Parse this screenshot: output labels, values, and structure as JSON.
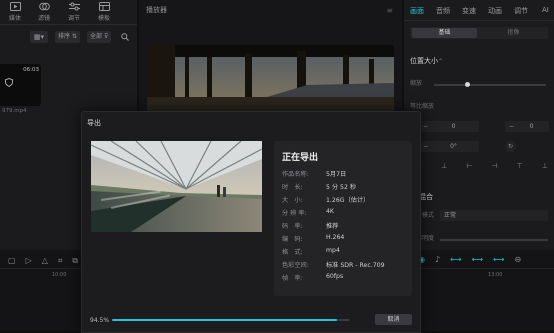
{
  "left_panel": {
    "tools": [
      {
        "label": "媒体",
        "icon": "media-icon"
      },
      {
        "label": "滤镜",
        "icon": "filter-icon"
      },
      {
        "label": "调节",
        "icon": "adjust-icon"
      },
      {
        "label": "模板",
        "icon": "template-icon"
      }
    ],
    "filter_chips": [
      "排序",
      "全部"
    ],
    "clip": {
      "duration": "06:03",
      "name": "979.mp4"
    }
  },
  "player": {
    "title": "播放器"
  },
  "right_panel": {
    "tabs": [
      "画面",
      "音频",
      "变速",
      "动画",
      "调节",
      "AI"
    ],
    "subtabs": [
      "基础",
      "抠像"
    ],
    "section_position": "位置大小",
    "scale_label": "缩放",
    "uniform_scale_label": "等比缩放",
    "position_x": "0",
    "position_y": "0",
    "rotation": "0°",
    "mix_label": "混合",
    "mix_mode_label": "混合模式",
    "mix_mode_value": "正常",
    "opacity_label": "不透明度"
  },
  "timeline": {
    "time_marks": [
      "10:00",
      "13:00"
    ]
  },
  "export_dialog": {
    "title": "导出",
    "status_heading": "正在导出",
    "fields": [
      {
        "label": "作品名称:",
        "value": "5月7日"
      },
      {
        "label": "时　长:",
        "value": "5 分 52 秒"
      },
      {
        "label": "大　小:",
        "value": "1.26G（估计）"
      },
      {
        "label": "分 辨 率:",
        "value": "4K"
      },
      {
        "label": "码　率:",
        "value": "推荐"
      },
      {
        "label": "编　码:",
        "value": "H.264"
      },
      {
        "label": "格　式:",
        "value": "mp4"
      },
      {
        "label": "色彩空间:",
        "value": "标准 SDR - Rec.709"
      },
      {
        "label": "帧　率:",
        "value": "60fps"
      }
    ],
    "progress_text": "94.5%",
    "progress": 0.945,
    "cancel_label": "取消"
  },
  "colors": {
    "accent": "#22c3d3",
    "background": "#0f0f10",
    "panel": "#1b1b1d"
  }
}
